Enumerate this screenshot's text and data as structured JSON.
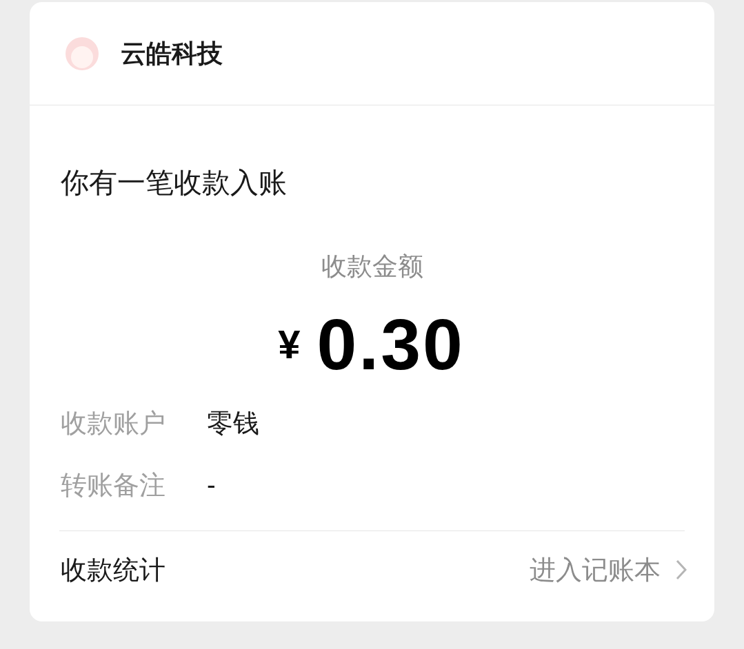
{
  "header": {
    "title": "云皓科技"
  },
  "heading": "你有一笔收款入账",
  "amount": {
    "label": "收款金额",
    "currency": "¥",
    "value": "0.30"
  },
  "details": [
    {
      "label": "收款账户",
      "value": "零钱"
    },
    {
      "label": "转账备注",
      "value": "-"
    }
  ],
  "footer": {
    "label": "收款统计",
    "link": "进入记账本"
  }
}
